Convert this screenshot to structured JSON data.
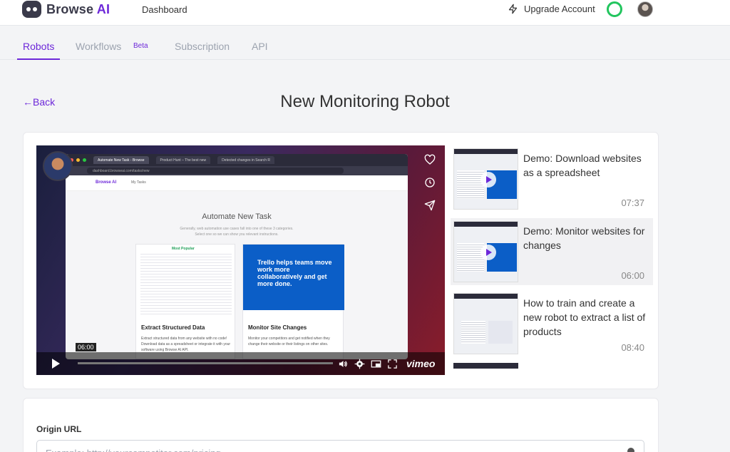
{
  "app": {
    "logo_main": "Browse",
    "logo_accent": "AI"
  },
  "header": {
    "dashboard_label": "Dashboard",
    "upgrade_label": "Upgrade Account"
  },
  "tabs": [
    {
      "label": "Robots",
      "active": true
    },
    {
      "label": "Workflows",
      "badge": "Beta"
    },
    {
      "label": "Subscription"
    },
    {
      "label": "API"
    }
  ],
  "page": {
    "back_label": "←Back",
    "title": "New Monitoring Robot"
  },
  "video": {
    "current_time": "06:00",
    "brand": "vimeo",
    "browser_tabs": [
      "Automate New Task - Browse",
      "Product Hunt – The best new",
      "Detected changes in Search R"
    ],
    "address": "dashboard.browseai.com/tasks/new",
    "inner_logo": "Browse AI",
    "inner_nav": "My Tasks",
    "inner_title": "Automate New Task",
    "inner_subtitle_1": "Generally, web automation use cases fall into one of these 3 categories.",
    "inner_subtitle_2": "Select one so we can show you relevant instructions.",
    "most_popular": "Most Popular",
    "card_left_title": "Extract Structured Data",
    "card_left_text": "Extract structured data from any website with no code! Download data as a spreadsheet or integrate it with your software using Browse AI API.",
    "card_right_promo": "Trello helps teams move work more collaboratively and get more done.",
    "card_right_title": "Monitor Site Changes",
    "card_right_text": "Monitor your competitors and get notified when they change their website or their listings on other sites."
  },
  "playlist": [
    {
      "title": "Demo: Download websites as a spreadsheet",
      "duration": "07:37",
      "active": false
    },
    {
      "title": "Demo: Monitor websites for changes",
      "duration": "06:00",
      "active": true
    },
    {
      "title": "How to train and create a new robot to extract a list of products",
      "duration": "08:40",
      "active": false
    }
  ],
  "origin": {
    "label": "Origin URL",
    "placeholder": "Example: http://yourcompetitor.com/pricing"
  },
  "colors": {
    "accent": "#6d28d9",
    "status_ring": "#22c55e"
  }
}
